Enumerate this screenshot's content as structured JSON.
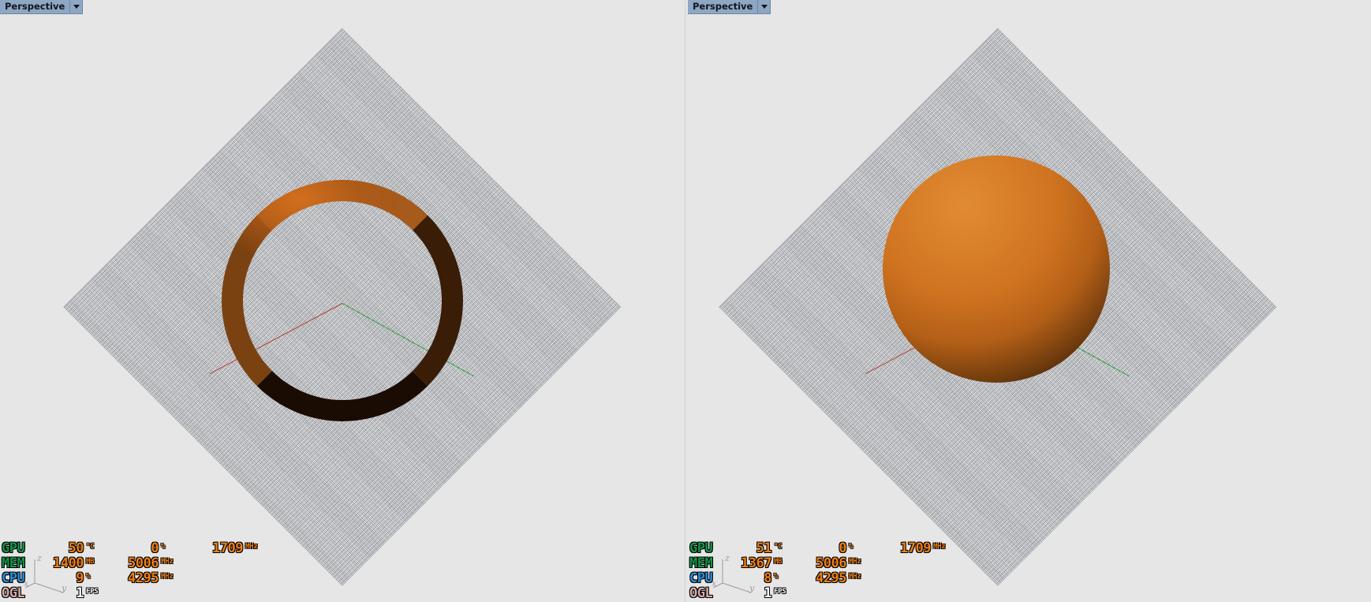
{
  "app": {
    "background_color": "#e6e6e6",
    "layout": "two-viewport-split"
  },
  "viewports": [
    {
      "id": "left",
      "view_selector": {
        "label": "Perspective",
        "icon": "chevron-down-icon",
        "options": [
          "Perspective"
        ]
      },
      "scene": {
        "object": "torus",
        "object_color": "#c0651b",
        "ground": "checkerboard-grid-plane",
        "axes": [
          {
            "name": "x-axis",
            "color": "#b63c32"
          },
          {
            "name": "y-axis",
            "color": "#2f9e3f"
          }
        ]
      },
      "hud": {
        "rows": [
          {
            "tag": "GPU",
            "tag_color": "#139549",
            "fields": [
              {
                "value": "50",
                "unit": "°C"
              },
              {
                "value": "0",
                "unit": "%"
              },
              {
                "value": "1709",
                "unit": "MHz"
              }
            ]
          },
          {
            "tag": "MEM",
            "tag_color": "#139549",
            "fields": [
              {
                "value": "1400",
                "unit": "MB"
              },
              {
                "value": "5006",
                "unit": "MHz"
              }
            ]
          },
          {
            "tag": "CPU",
            "tag_color": "#2b8fd8",
            "fields": [
              {
                "value": "9",
                "unit": "%"
              },
              {
                "value": "4295",
                "unit": "MHz"
              }
            ]
          },
          {
            "tag": "OGL",
            "tag_color": "#d6a8a8",
            "fields": [
              {
                "value": "1",
                "unit": "FPS"
              }
            ]
          }
        ]
      },
      "gizmo": {
        "axis_labels": [
          "z",
          "y",
          "x"
        ],
        "color": "#9b9b9b"
      }
    },
    {
      "id": "right",
      "view_selector": {
        "label": "Perspective",
        "icon": "chevron-down-icon",
        "options": [
          "Perspective"
        ]
      },
      "scene": {
        "object": "sphere",
        "object_color": "#d1751e",
        "ground": "checkerboard-grid-plane",
        "axes": [
          {
            "name": "x-axis",
            "color": "#b63c32"
          },
          {
            "name": "y-axis",
            "color": "#2f9e3f"
          }
        ]
      },
      "hud": {
        "rows": [
          {
            "tag": "GPU",
            "tag_color": "#139549",
            "fields": [
              {
                "value": "51",
                "unit": "°C"
              },
              {
                "value": "0",
                "unit": "%"
              },
              {
                "value": "1709",
                "unit": "MHz"
              }
            ]
          },
          {
            "tag": "MEM",
            "tag_color": "#139549",
            "fields": [
              {
                "value": "1367",
                "unit": "MB"
              },
              {
                "value": "5006",
                "unit": "MHz"
              }
            ]
          },
          {
            "tag": "CPU",
            "tag_color": "#2b8fd8",
            "fields": [
              {
                "value": "8",
                "unit": "%"
              },
              {
                "value": "4295",
                "unit": "MHz"
              }
            ]
          },
          {
            "tag": "OGL",
            "tag_color": "#d6a8a8",
            "fields": [
              {
                "value": "1",
                "unit": "FPS"
              }
            ]
          }
        ]
      },
      "gizmo": {
        "axis_labels": [
          "z",
          "y",
          "x"
        ],
        "color": "#9b9b9b"
      }
    }
  ]
}
